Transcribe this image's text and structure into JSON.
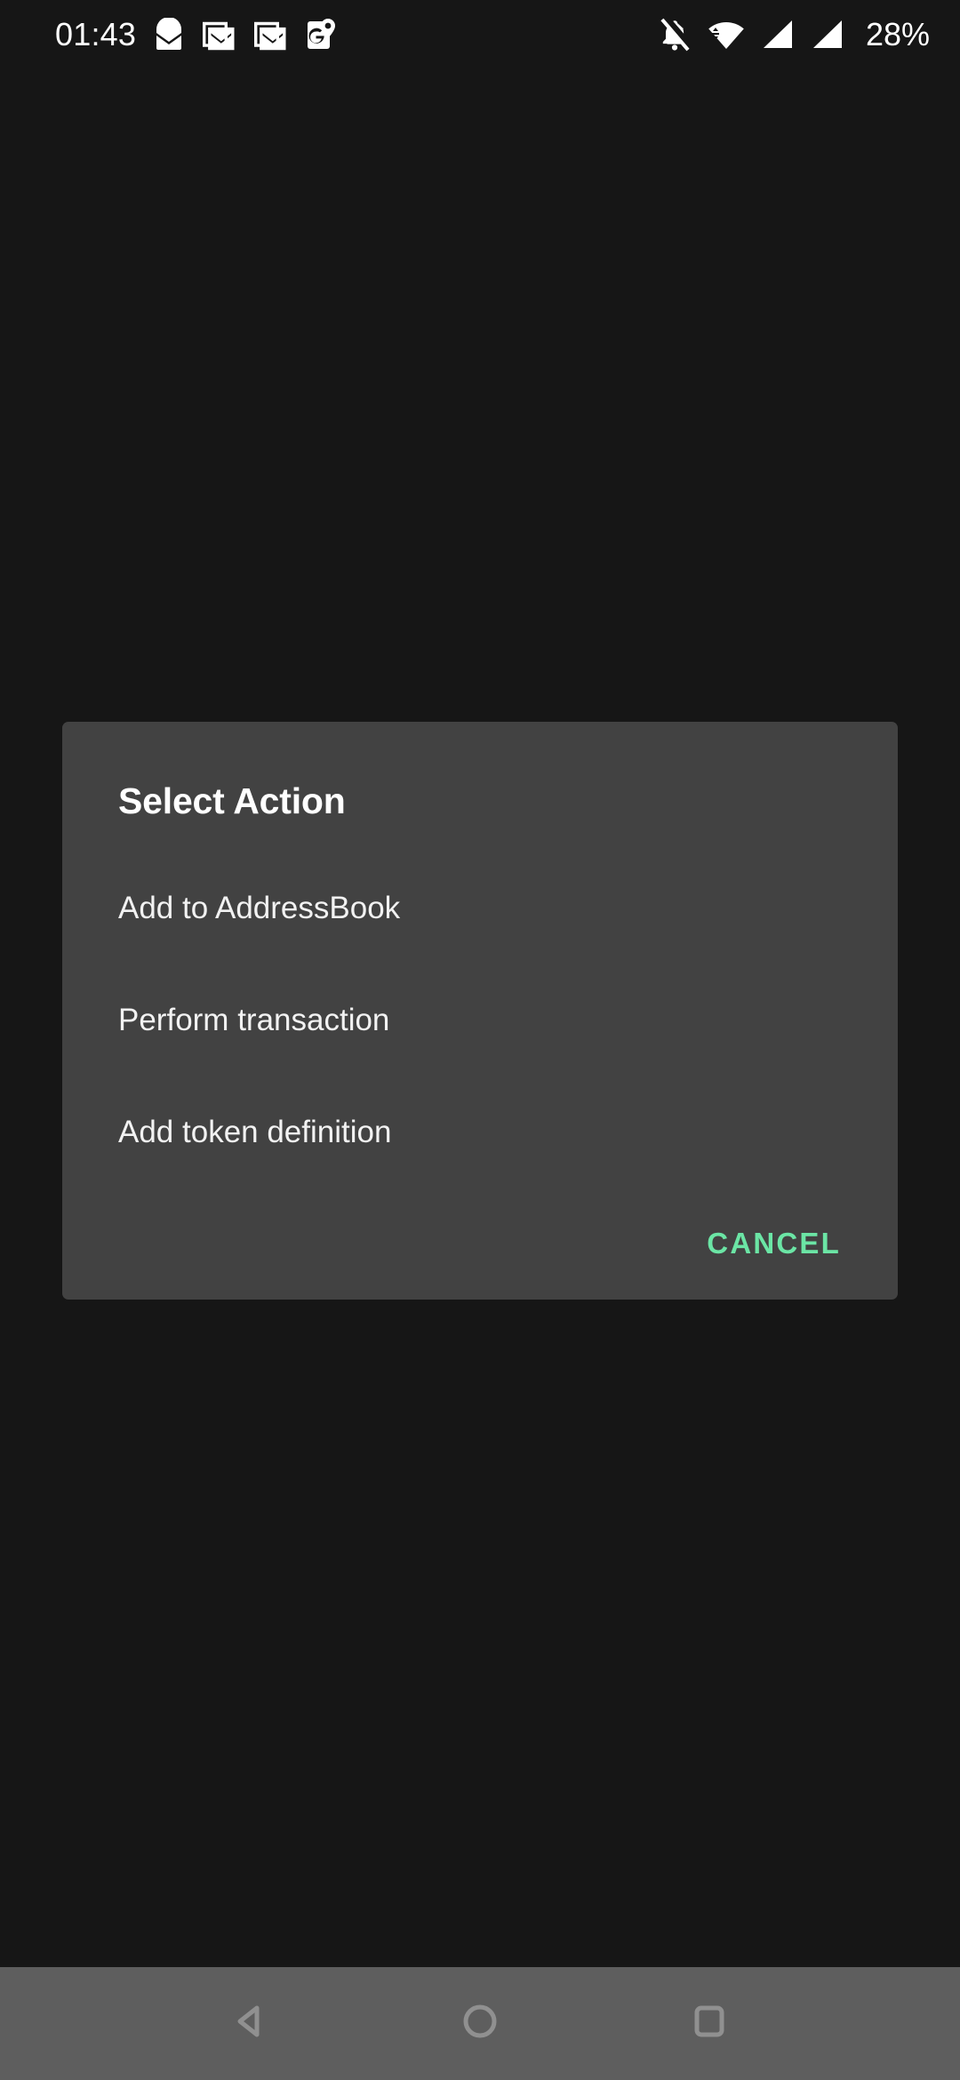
{
  "status_bar": {
    "time": "01:43",
    "battery": "28%",
    "background_color": "#161616",
    "foreground_color": "#ffffff",
    "left_icons": [
      {
        "name": "protonmail-icon",
        "label": "ProtonMail notification"
      },
      {
        "name": "gmail-icon",
        "label": "Gmail notification"
      },
      {
        "name": "gmail-icon-2",
        "label": "Gmail notification"
      },
      {
        "name": "google-maps-icon",
        "label": "Google Maps notification"
      }
    ],
    "right_icons": [
      {
        "name": "notifications-muted-icon",
        "label": "Ringer silenced"
      },
      {
        "name": "wifi-icon",
        "label": "Wi-Fi connected"
      },
      {
        "name": "signal-sim1-icon",
        "label": "Cellular signal SIM 1"
      },
      {
        "name": "signal-sim2-icon",
        "label": "Cellular signal SIM 2"
      }
    ]
  },
  "dialog": {
    "title": "Select Action",
    "background_color": "#424242",
    "items": [
      {
        "label": "Add to AddressBook"
      },
      {
        "label": "Perform transaction"
      },
      {
        "label": "Add token definition"
      }
    ],
    "cancel_label": "CANCEL",
    "accent_color": "#6BE5A5"
  },
  "nav_bar": {
    "background_color": "#5e5e5e",
    "icon_color": "#909090",
    "buttons": [
      {
        "name": "back-button",
        "icon": "back-triangle-icon",
        "label": "Back"
      },
      {
        "name": "home-button",
        "icon": "home-circle-icon",
        "label": "Home"
      },
      {
        "name": "recents-button",
        "icon": "recents-square-icon",
        "label": "Recent apps"
      }
    ]
  }
}
